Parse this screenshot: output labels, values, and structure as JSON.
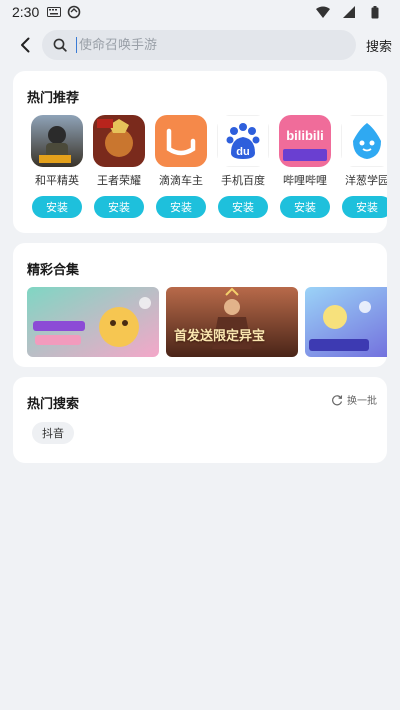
{
  "status_bar": {
    "time": "2:30"
  },
  "search": {
    "placeholder": "使命召唤手游",
    "button_label": "搜索"
  },
  "recommend": {
    "title": "热门推荐",
    "apps": [
      {
        "name": "和平精英",
        "install_label": "安装",
        "icon": "pubg-icon"
      },
      {
        "name": "王者荣耀",
        "install_label": "安装",
        "icon": "honor-of-kings-icon"
      },
      {
        "name": "滴滴车主",
        "install_label": "安装",
        "icon": "didi-icon"
      },
      {
        "name": "手机百度",
        "install_label": "安装",
        "icon": "baidu-icon"
      },
      {
        "name": "哔哩哔哩",
        "install_label": "安装",
        "icon": "bilibili-icon"
      },
      {
        "name": "洋葱学园",
        "install_label": "安装",
        "icon": "onion-academy-icon"
      }
    ]
  },
  "collection": {
    "title": "精彩合集",
    "banners": [
      {
        "icon": "candy-game-banner"
      },
      {
        "icon": "warrior-game-banner",
        "text": "首发送限定异宝"
      },
      {
        "icon": "fantasy-game-banner"
      }
    ]
  },
  "hot_search": {
    "title": "热门搜索",
    "refresh_label": "换一批",
    "chips": [
      "抖音"
    ]
  },
  "colors": {
    "accent": "#1ec0dc",
    "background": "#f0f2f5",
    "card": "#ffffff"
  }
}
